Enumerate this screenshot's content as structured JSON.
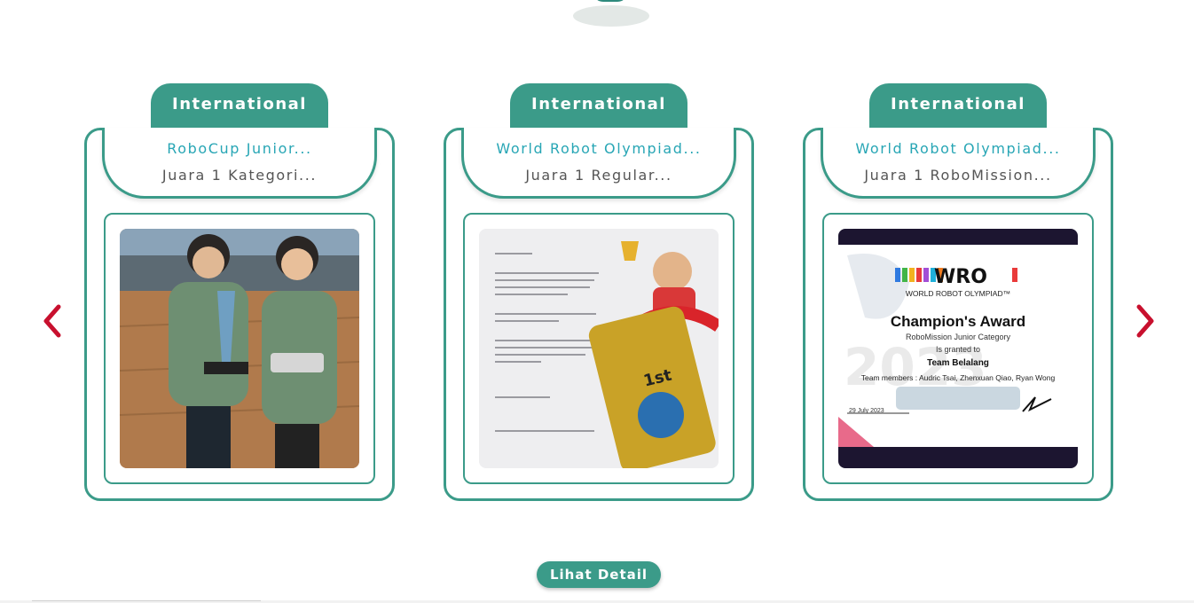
{
  "colors": {
    "accent": "#3b9b89",
    "title": "#28a6b5",
    "arrow": "#c8102e"
  },
  "navigation": {
    "prev_icon": "chevron-left-icon",
    "next_icon": "chevron-right-icon"
  },
  "cards": [
    {
      "tag": "International",
      "title": "RoboCup Junior...",
      "subtitle": "Juara 1 Kategori..."
    },
    {
      "tag": "International",
      "title": "World Robot Olympiad...",
      "subtitle": "Juara 1 Regular..."
    },
    {
      "tag": "International",
      "title": "World Robot Olympiad...",
      "subtitle": "Juara 1 RoboMission...",
      "certificate": {
        "logo_text": "WRO",
        "org": "WORLD ROBOT OLYMPIAD™",
        "heading": "Champion's Award",
        "category": "RoboMission   Junior Category",
        "granted": "Is granted to",
        "team": "Team Belalang",
        "members": "Team members : Audric Tsai, Zhenxuan Qiao, Ryan Wong",
        "date": "29 July 2023",
        "year": "2023"
      }
    }
  ],
  "detail_button": {
    "label": "Lihat Detail"
  }
}
